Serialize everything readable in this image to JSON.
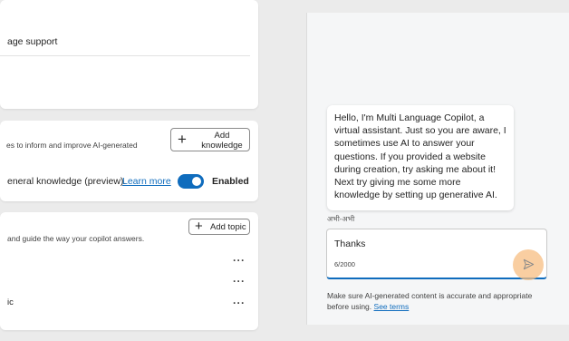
{
  "card_language": {
    "row_text": "age support"
  },
  "card_knowledge": {
    "description": "es to inform and improve AI-generated",
    "add_knowledge_label_line1": "Add",
    "add_knowledge_label_line2": "knowledge",
    "general_knowledge_text": "eneral knowledge (preview).",
    "learn_more": "Learn more",
    "toggle_state_label": "Enabled",
    "toggle_on": true
  },
  "card_topics": {
    "description": "and guide the way your copilot answers.",
    "add_topic_label": "Add topic",
    "rows": [
      {
        "label": "",
        "menu": "···"
      },
      {
        "label": "",
        "menu": "···"
      },
      {
        "label": "ic",
        "menu": "···"
      }
    ]
  },
  "chat": {
    "bot_message": "Hello, I'm Multi Language Copilot, a virtual assistant. Just so you are aware, I sometimes use AI to answer your questions. If you provided a website during creation, try asking me about it! Next try giving me some more knowledge by setting up generative AI.",
    "timestamp": "अभी-अभी",
    "input_value": "Thanks",
    "char_count": "6/2000",
    "disclaimer_text": "Make sure AI-generated content is accurate and appropriate before using.",
    "see_terms": "See terms"
  },
  "colors": {
    "accent": "#0f6cbd",
    "highlight": "#f7be82"
  }
}
